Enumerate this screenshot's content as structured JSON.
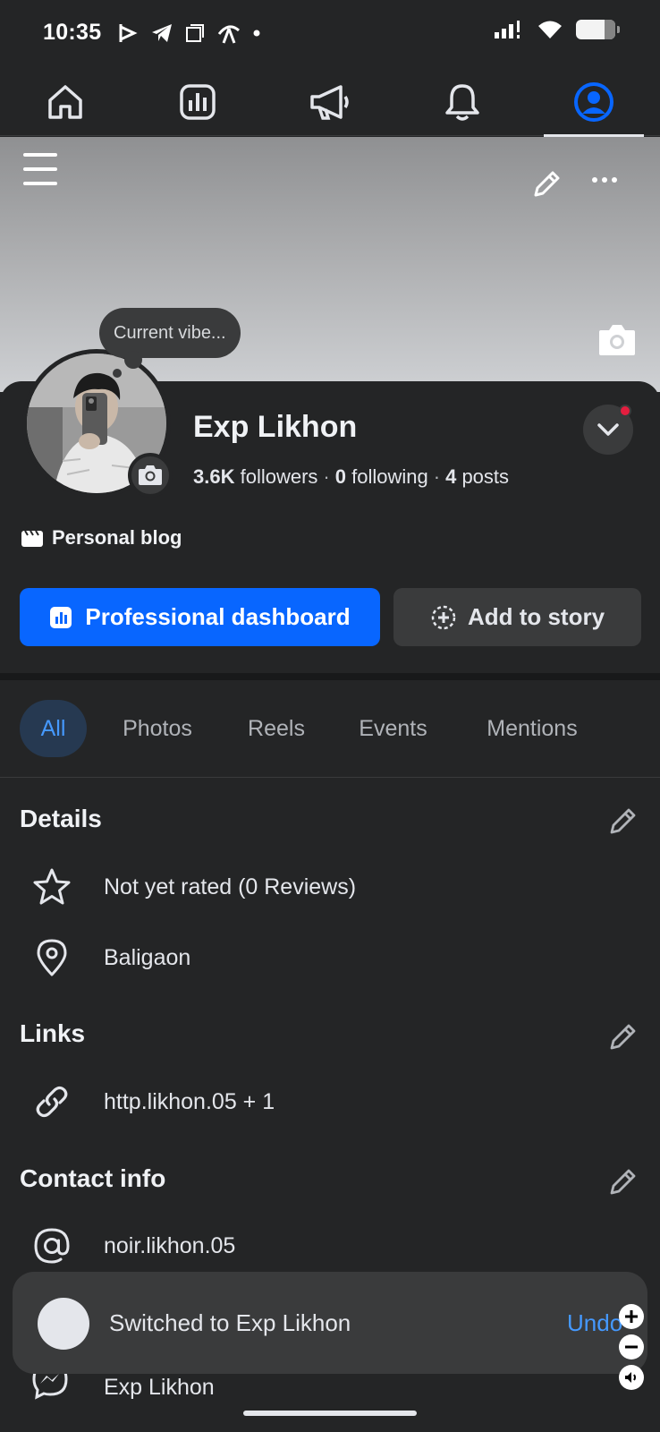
{
  "status": {
    "time": "10:35",
    "left_icons": [
      "bkash-icon",
      "telegram-icon",
      "copy-icon",
      "telco-icon",
      "dot-icon"
    ],
    "right_icons": [
      "signal-icon",
      "wifi-icon",
      "battery-icon"
    ]
  },
  "nav": {
    "items": [
      {
        "name": "home-icon"
      },
      {
        "name": "dashboard-icon"
      },
      {
        "name": "megaphone-icon"
      },
      {
        "name": "bell-icon"
      },
      {
        "name": "profile-icon",
        "active": true
      }
    ],
    "active_color": "#0866ff"
  },
  "cover": {
    "vibe": "Current vibe..."
  },
  "profile": {
    "name": "Exp Likhon",
    "followers": "3.6K",
    "followers_label": "followers",
    "following": "0",
    "following_label": "following",
    "posts": "4",
    "posts_label": "posts",
    "separator": "·",
    "category": "Personal blog"
  },
  "actions": {
    "dashboard": "Professional dashboard",
    "story": "Add to story",
    "primary_color": "#0866ff"
  },
  "tabs": [
    {
      "label": "All",
      "active": true
    },
    {
      "label": "Photos"
    },
    {
      "label": "Reels"
    },
    {
      "label": "Events"
    },
    {
      "label": "Mentions"
    }
  ],
  "details": {
    "title": "Details",
    "rating": "Not yet rated (0 Reviews)",
    "location": "Baligaon"
  },
  "links": {
    "title": "Links",
    "link": "http.likhon.05 + 1"
  },
  "contact": {
    "title": "Contact info",
    "handle": "noir.likhon.05",
    "messenger": "Exp Likhon"
  },
  "toast": {
    "message": "Switched to Exp Likhon",
    "undo": "Undo"
  }
}
